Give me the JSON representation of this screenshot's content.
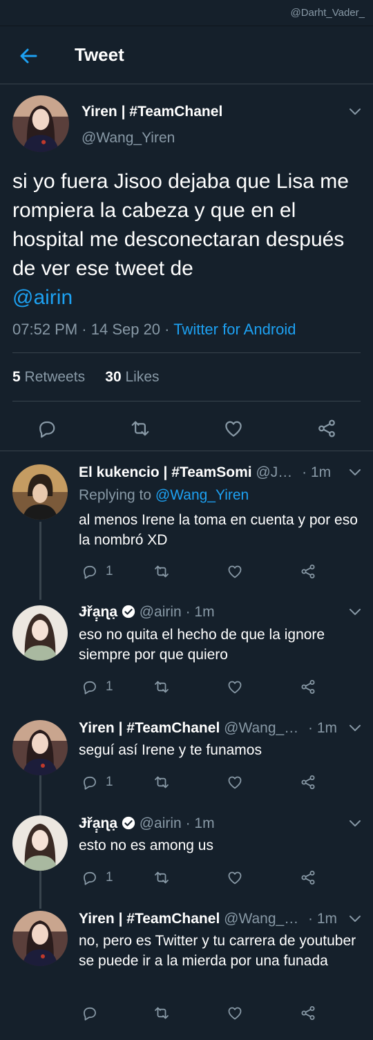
{
  "watermark": "@Darht_Vader_",
  "header": {
    "title": "Tweet"
  },
  "tweet": {
    "name": "Yiren | #TeamChanel",
    "handle": "@Wang_Yiren",
    "text": "si yo fuera Jisoo dejaba que Lisa me rompiera la cabeza y que en el hospital me desconectaran después de ver ese tweet de",
    "mention": "@airin",
    "time": "07:52 PM",
    "date": "14 Sep 20",
    "source": "Twitter for Android",
    "retweets_count": "5",
    "retweets_label": "Retweets",
    "likes_count": "30",
    "likes_label": "Likes"
  },
  "replies": [
    {
      "name": "El kukencio | #TeamSomi",
      "handle": "@J…",
      "time": "· 1m",
      "replying_prefix": "Replying to",
      "replying_to": "@Wang_Yiren",
      "text": "al menos Irene la toma en cuenta y por eso la nombró XD",
      "reply_count": "1"
    },
    {
      "name": "Ɉřạ̣ɳạ",
      "handle": "@airin",
      "time": "· 1m",
      "text": "eso no quita el hecho de que la ignore siempre por que quiero",
      "reply_count": "1"
    },
    {
      "name": "Yiren | #TeamChanel",
      "handle": "@Wang_…",
      "time": "· 1m",
      "text": "seguí así Irene y te funamos",
      "reply_count": "1"
    },
    {
      "name": "Ɉřạ̣ɳạ",
      "handle": "@airin",
      "time": "· 1m",
      "text": "esto no es among us",
      "reply_count": "1"
    },
    {
      "name": "Yiren | #TeamChanel",
      "handle": "@Wang_…",
      "time": "· 1m",
      "text": "no, pero es Twitter y tu carrera de youtuber se puede ir a la mierda por una funada",
      "reply_count": ""
    }
  ],
  "colors": {
    "background": "#15202b",
    "accent": "#1da1f2",
    "muted": "#8899a6",
    "border": "#38444d"
  },
  "icons": [
    "back-arrow-icon",
    "chevron-down-icon",
    "reply-icon",
    "retweet-icon",
    "like-icon",
    "share-icon",
    "verified-icon"
  ]
}
